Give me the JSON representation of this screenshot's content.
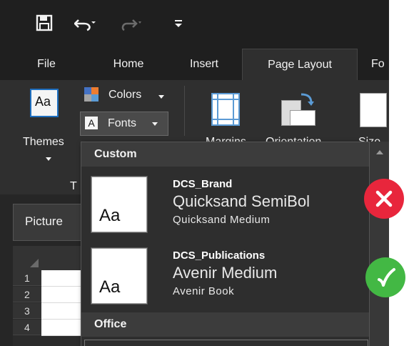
{
  "qat": {
    "icons": [
      "save-icon",
      "undo-icon",
      "redo-icon",
      "customize-qat-icon"
    ]
  },
  "tabs": [
    {
      "label": "File",
      "active": false
    },
    {
      "label": "Home",
      "active": false
    },
    {
      "label": "Insert",
      "active": false
    },
    {
      "label": "Page Layout",
      "active": true
    },
    {
      "label": "Fo",
      "active": false
    }
  ],
  "ribbon": {
    "themes_label": "Themes",
    "colors_label": "Colors",
    "fonts_label": "Fonts",
    "margins_label": "Margins",
    "orientation_label": "Orientation",
    "size_label": "Size",
    "group_label_fragment": "T",
    "thumb_text": "Aa"
  },
  "formula_bar": {
    "name_box": "Picture"
  },
  "rows": [
    "1",
    "2",
    "3",
    "4"
  ],
  "dropdown": {
    "sections": [
      {
        "title": "Custom",
        "items": [
          {
            "name": "DCS_Brand",
            "heading_font": "Quicksand SemiBol",
            "body_font": "Quicksand Medium",
            "preview": "Aa"
          },
          {
            "name": "DCS_Publications",
            "heading_font": "Avenir Medium",
            "body_font": "Avenir Book",
            "preview": "Aa"
          }
        ]
      },
      {
        "title": "Office",
        "items": []
      }
    ]
  },
  "marks": [
    {
      "icon": "x-mark-icon",
      "color": "#e8263c"
    },
    {
      "icon": "check-mark-icon",
      "color": "#43b844"
    }
  ]
}
